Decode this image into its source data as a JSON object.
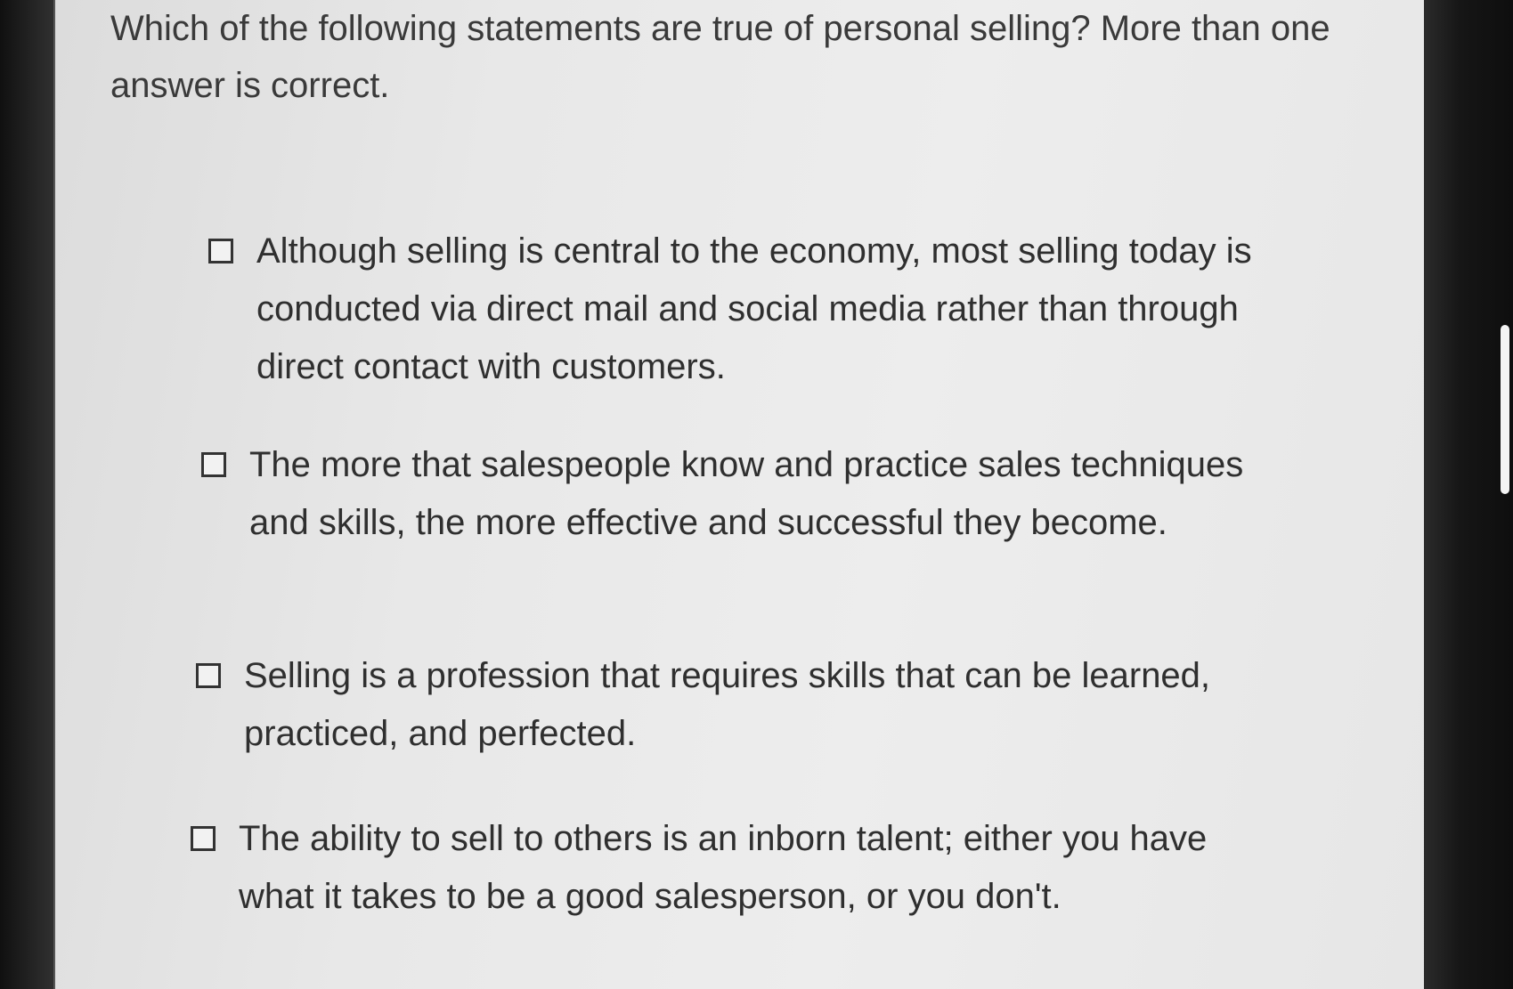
{
  "question": {
    "text": "Which of the following statements are true of personal selling? More than one answer is correct."
  },
  "options": [
    {
      "label": "Although selling is central to the economy, most selling today is conducted via direct mail and social media rather than through direct contact with customers.",
      "checked": false
    },
    {
      "label": "The more that salespeople know and practice sales techniques and skills, the more effective and successful they become.",
      "checked": false
    },
    {
      "label": "Selling is a profession that requires skills that can be learned, practiced, and perfected.",
      "checked": false
    },
    {
      "label": "The ability to sell to others is an inborn talent; either you have what it takes to be a good salesperson, or you don't.",
      "checked": false
    }
  ]
}
